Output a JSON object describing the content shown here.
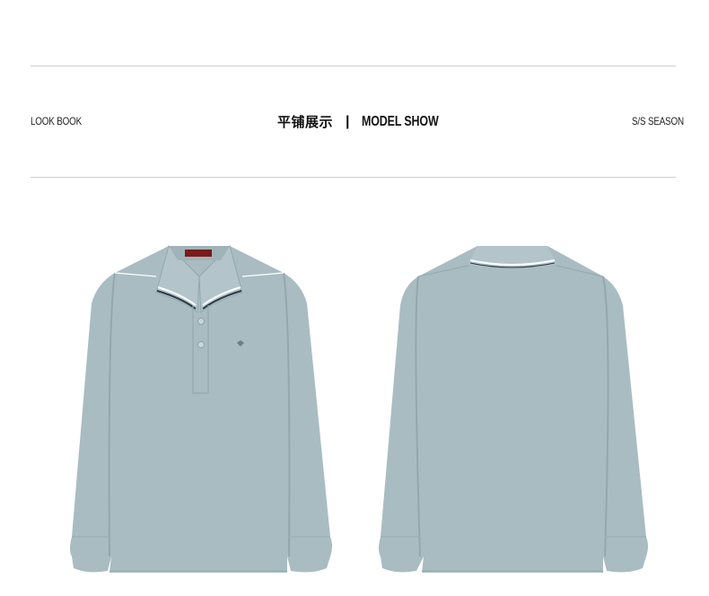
{
  "header": {
    "left_label": "LOOK BOOK",
    "center_cn": "平铺展示",
    "separator": "|",
    "center_en": "MODEL SHOW",
    "right_label": "S/S SEASON"
  },
  "images": {
    "front": "front-view-polo-shirt",
    "back": "back-view-polo-shirt"
  },
  "colors": {
    "shirt": "#a9bcc2",
    "shirt_shadow": "#93a8ae",
    "collar_stripe_dark": "#2b3a44",
    "collar_stripe_light": "#ffffff",
    "rule": "#cfcfcf"
  }
}
